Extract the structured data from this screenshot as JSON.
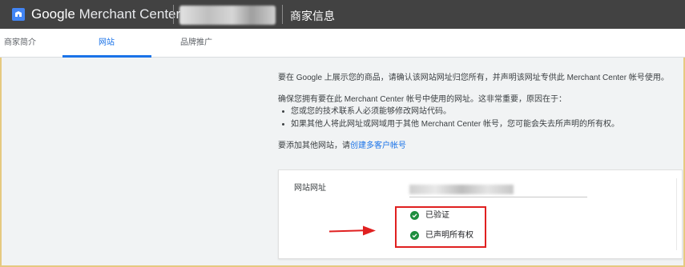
{
  "header": {
    "brand_google": "Google",
    "brand_product": "Merchant Center",
    "page_title": "商家信息"
  },
  "tabs": [
    {
      "label": "商家简介"
    },
    {
      "label": "网站",
      "active": true
    },
    {
      "label": "品牌推广"
    }
  ],
  "content": {
    "intro": "要在 Google 上展示您的商品，请确认该网站网址归您所有，并声明该网址专供此 Merchant Center 帐号使用。",
    "ensure": "确保您拥有要在此 Merchant Center 帐号中使用的网址。这非常重要，原因在于：",
    "bullets": [
      "您或您的技术联系人必须能够修改网站代码。",
      "如果其他人将此网址或网域用于其他 Merchant Center 帐号，您可能会失去所声明的所有权。"
    ],
    "add_prefix": "要添加其他网站，请",
    "add_link": "创建多客户帐号"
  },
  "card": {
    "url_label": "网站网址",
    "status_verified": "已验证",
    "status_claimed": "已声明所有权"
  },
  "colors": {
    "topbar": "#424242",
    "accent": "#1a73e8",
    "success": "#1e8e3e",
    "highlight": "#e02020"
  }
}
